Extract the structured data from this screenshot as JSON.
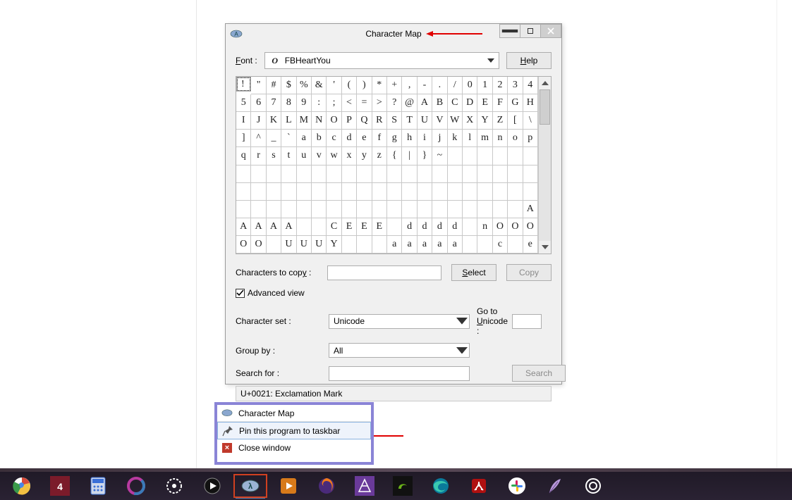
{
  "window": {
    "title": "Character Map",
    "font_label": "Font :",
    "font_value": "FBHeartYou",
    "help_label": "Help",
    "chars_to_copy_label": "Characters to copy :",
    "chars_to_copy_value": "",
    "select_label": "Select",
    "copy_label": "Copy",
    "advanced_view_label": "Advanced view",
    "advanced_view_checked": true,
    "character_set_label": "Character set :",
    "character_set_value": "Unicode",
    "group_by_label": "Group by :",
    "group_by_value": "All",
    "goto_unicode_label": "Go to Unicode :",
    "goto_unicode_value": "",
    "search_for_label": "Search for :",
    "search_for_value": "",
    "search_button": "Search",
    "statusbar": "U+0021: Exclamation Mark"
  },
  "grid": {
    "cols": 20,
    "rows": 10,
    "selected_index": 0,
    "chars": [
      "!",
      "\"",
      "#",
      "$",
      "%",
      "&",
      "'",
      "(",
      ")",
      "*",
      "+",
      ",",
      "-",
      ".",
      "/",
      "0",
      "1",
      "2",
      "3",
      "4",
      "5",
      "6",
      "7",
      "8",
      "9",
      ":",
      ";",
      "<",
      "=",
      ">",
      "?",
      "@",
      "A",
      "B",
      "C",
      "D",
      "E",
      "F",
      "G",
      "H",
      "I",
      "J",
      "K",
      "L",
      "M",
      "N",
      "O",
      "P",
      "Q",
      "R",
      "S",
      "T",
      "U",
      "V",
      "W",
      "X",
      "Y",
      "Z",
      "[",
      "\\",
      "]",
      "^",
      "_",
      "`",
      "a",
      "b",
      "c",
      "d",
      "e",
      "f",
      "g",
      "h",
      "i",
      "j",
      "k",
      "l",
      "m",
      "n",
      "o",
      "p",
      "q",
      "r",
      "s",
      "t",
      "u",
      "v",
      "w",
      "x",
      "y",
      "z",
      "{",
      "|",
      "}",
      "~",
      "",
      "",
      "",
      "",
      "",
      "",
      "",
      "",
      "",
      "",
      "",
      "",
      "",
      "",
      "",
      "",
      "",
      "",
      "",
      "",
      "",
      "",
      "",
      "",
      "",
      "",
      "",
      "",
      "",
      "",
      "",
      "",
      "",
      "",
      "",
      "",
      "",
      "",
      "",
      "",
      "",
      "",
      "",
      "",
      "",
      "",
      "",
      "",
      "",
      "",
      "",
      "",
      "",
      "",
      "",
      "",
      "",
      "",
      "",
      "",
      "",
      "",
      "",
      "",
      "",
      "A",
      "A",
      "A",
      "A",
      "A",
      "",
      "",
      "C",
      "E",
      "E",
      "E",
      "",
      "d",
      "d",
      "d",
      "d",
      "",
      "n",
      "O",
      "O",
      "O",
      "O",
      "O",
      "",
      "U",
      "U",
      "U",
      "Y",
      "",
      "",
      "",
      "a",
      "a",
      "a",
      "a",
      "a",
      "",
      "",
      "c",
      "",
      "e"
    ]
  },
  "flyout": {
    "items": [
      {
        "label": "Character Map",
        "icon": "charmap-icon"
      },
      {
        "label": "Pin this program to taskbar",
        "icon": "pin-icon",
        "highlighted": true
      },
      {
        "label": "Close window",
        "icon": "close-red-icon"
      }
    ]
  },
  "taskbar": {
    "items": [
      {
        "name": "chrome",
        "color": "#fff"
      },
      {
        "name": "foobar",
        "color": "#7b1b2a"
      },
      {
        "name": "calculator",
        "color": "#3a6fd8"
      },
      {
        "name": "sharex",
        "color": "#5a2a7a"
      },
      {
        "name": "settings",
        "color": "#222"
      },
      {
        "name": "media",
        "color": "#111"
      },
      {
        "name": "charmap",
        "color": "#4a6a90",
        "active": true,
        "running": true
      },
      {
        "name": "videoplayer",
        "color": "#d87a1a"
      },
      {
        "name": "firefox",
        "color": "#222"
      },
      {
        "name": "affinity",
        "color": "#6a3a9a"
      },
      {
        "name": "nvidia",
        "color": "#111"
      },
      {
        "name": "edge",
        "color": "#0a5a9a"
      },
      {
        "name": "acrobat",
        "color": "#b01010"
      },
      {
        "name": "slack",
        "color": "#fff"
      },
      {
        "name": "feather",
        "color": "#6a4a8a"
      },
      {
        "name": "steelseries",
        "color": "#222"
      }
    ]
  }
}
